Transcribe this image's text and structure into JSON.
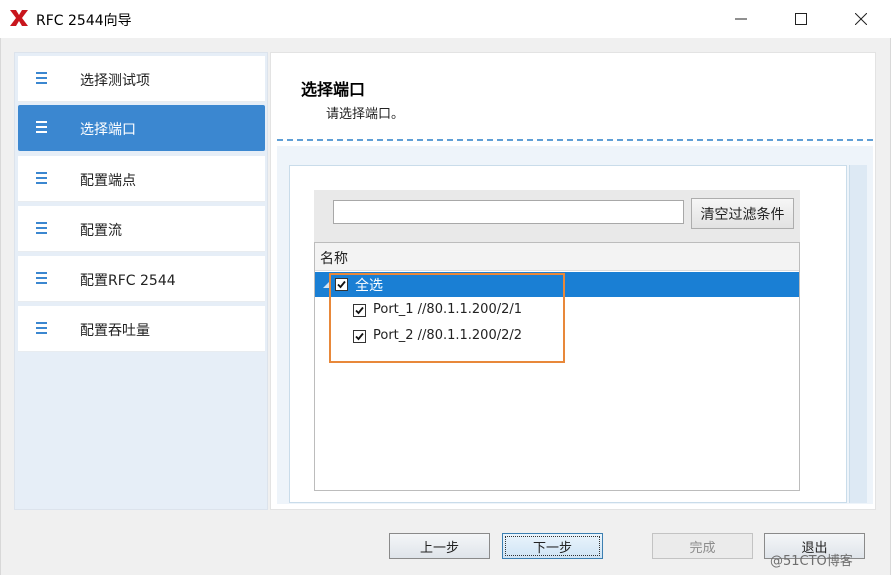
{
  "window": {
    "title": "RFC 2544向导",
    "logo_icon": "red-x-logo",
    "controls": [
      "minimize-icon",
      "maximize-icon",
      "close-icon"
    ]
  },
  "sidebar": {
    "items": [
      {
        "label": "选择测试项",
        "icon": "list-icon",
        "active": false
      },
      {
        "label": "选择端口",
        "icon": "list-icon",
        "active": true
      },
      {
        "label": "配置端点",
        "icon": "list-icon",
        "active": false
      },
      {
        "label": "配置流",
        "icon": "list-icon",
        "active": false
      },
      {
        "label": "配置RFC 2544",
        "icon": "list-icon",
        "active": false
      },
      {
        "label": "配置吞吐量",
        "icon": "list-icon",
        "active": false
      }
    ]
  },
  "page": {
    "title": "选择端口",
    "subtitle": "请选择端口。"
  },
  "filter": {
    "value": "",
    "clear_button": "清空过滤条件"
  },
  "tree": {
    "header": "名称",
    "select_all": {
      "label": "全选",
      "checked": true
    },
    "ports": [
      {
        "label": "Port_1 //80.1.1.200/2/1",
        "checked": true
      },
      {
        "label": "Port_2 //80.1.1.200/2/2",
        "checked": true
      }
    ]
  },
  "footer": {
    "prev": "上一步",
    "next": "下一步",
    "finish": "完成",
    "exit": "退出"
  },
  "watermark": "@51CTO博客",
  "colors": {
    "active_nav": "#3b87d0",
    "selection": "#1a7fd4",
    "highlight_outline": "#e8883a",
    "dashed_separator": "#5f9fd6"
  }
}
